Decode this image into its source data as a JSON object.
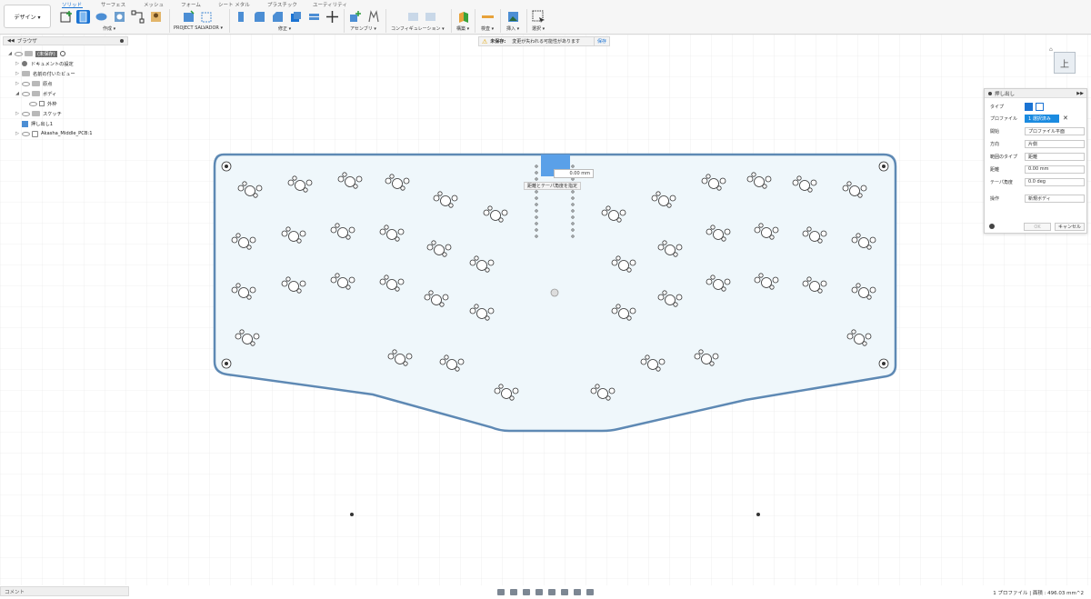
{
  "toolbar": {
    "design_label": "デザイン ▾",
    "tabs": [
      "ソリッド",
      "サーフェス",
      "メッシュ",
      "フォーム",
      "シート メタル",
      "プラスチック",
      "ユーティリティ"
    ],
    "groups": {
      "create": "作成 ▾",
      "salvador": "PROJECT SALVADOR ▾",
      "modify": "修正 ▾",
      "assembly": "アセンブリ ▾",
      "configure": "コンフィギュレーション ▾",
      "construct": "構築 ▾",
      "inspect": "検査 ▾",
      "insert": "挿入 ▾",
      "select": "選択 ▾"
    }
  },
  "browser": {
    "title": "ブラウザ",
    "items": [
      {
        "label": "(未保存)"
      },
      {
        "label": "ドキュメントの設定"
      },
      {
        "label": "名前の付いたビュー"
      },
      {
        "label": "原点"
      },
      {
        "label": "ボディ"
      },
      {
        "label": "外枠"
      },
      {
        "label": "スケッチ"
      },
      {
        "label": "押し出し1"
      },
      {
        "label": "Akasha_Middle_PCB:1"
      }
    ]
  },
  "banner": {
    "tag": "未保存:",
    "message": "変更が失われる可能性があります",
    "save": "保存"
  },
  "canvas": {
    "dimension_value": "0.00 mm",
    "tooltip": "距離とテーパ角度を指定"
  },
  "viewcube": {
    "face": "上"
  },
  "extrude": {
    "title": "押し出し",
    "rows": {
      "type_label": "タイプ",
      "profile_label": "プロファイル",
      "profile_value": "1 選択済み",
      "start_label": "開始",
      "start_value": "プロファイル平面",
      "direction_label": "方向",
      "direction_value": "片側",
      "extent_label": "範囲のタイプ",
      "extent_value": "距離",
      "distance_label": "距離",
      "distance_value": "0.00 mm",
      "taper_label": "テーパ角度",
      "taper_value": "0.0 deg",
      "operation_label": "操作",
      "operation_value": "新規ボディ"
    },
    "ok": "OK",
    "cancel": "キャンセル"
  },
  "comment": {
    "label": "コメント"
  },
  "status": {
    "text": "1 プロファイル | 面積 : 496.03 mm^2"
  }
}
